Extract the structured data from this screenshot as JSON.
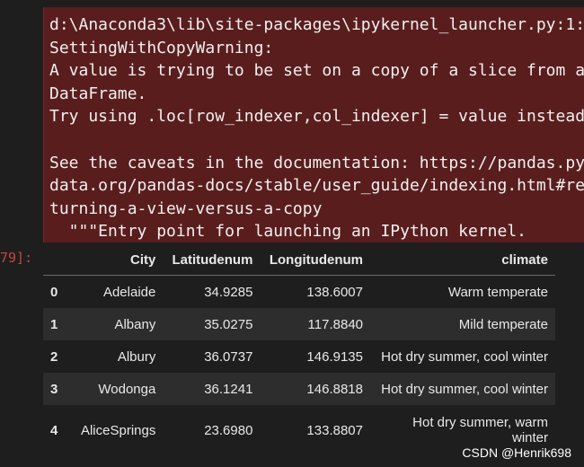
{
  "output": {
    "stderr_lines": [
      "d:\\Anaconda3\\lib\\site-packages\\ipykernel_launcher.py:1:",
      "SettingWithCopyWarning:",
      "A value is trying to be set on a copy of a slice from a",
      "DataFrame.",
      "Try using .loc[row_indexer,col_indexer] = value instead",
      "",
      "See the caveats in the documentation: https://pandas.py",
      "data.org/pandas-docs/stable/user_guide/indexing.html#re",
      "turning-a-view-versus-a-copy",
      "  \"\"\"Entry point for launching an IPython kernel."
    ],
    "prompt": "79]:",
    "colors": {
      "stderr_bg": "#5a1d1d",
      "prompt": "#c04a3c",
      "row_alt": "#2d2d2d"
    }
  },
  "table": {
    "columns": [
      "",
      "City",
      "Latitudenum",
      "Longitudenum",
      "climate"
    ],
    "rows": [
      {
        "index": "0",
        "City": "Adelaide",
        "Latitudenum": "34.9285",
        "Longitudenum": "138.6007",
        "climate": "Warm temperate"
      },
      {
        "index": "1",
        "City": "Albany",
        "Latitudenum": "35.0275",
        "Longitudenum": "117.8840",
        "climate": "Mild temperate"
      },
      {
        "index": "2",
        "City": "Albury",
        "Latitudenum": "36.0737",
        "Longitudenum": "146.9135",
        "climate": "Hot dry summer, cool winter"
      },
      {
        "index": "3",
        "City": "Wodonga",
        "Latitudenum": "36.1241",
        "Longitudenum": "146.8818",
        "climate": "Hot dry summer, cool winter"
      },
      {
        "index": "4",
        "City": "AliceSprings",
        "Latitudenum": "23.6980",
        "Longitudenum": "133.8807",
        "climate": "Hot dry summer, warm winter"
      }
    ]
  },
  "watermark": "CSDN @Henrik698"
}
